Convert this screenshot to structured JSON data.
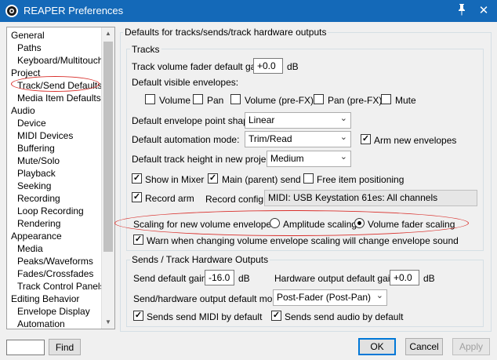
{
  "window": {
    "title": "REAPER Preferences",
    "pin_glyph": "📌",
    "close_glyph": "✕"
  },
  "tree": {
    "items": [
      {
        "label": "General"
      },
      {
        "label": "Paths"
      },
      {
        "label": "Keyboard/Multitouch"
      },
      {
        "label": "Project"
      },
      {
        "label": "Track/Send Defaults"
      },
      {
        "label": "Media Item Defaults"
      },
      {
        "label": "Audio"
      },
      {
        "label": "Device"
      },
      {
        "label": "MIDI Devices"
      },
      {
        "label": "Buffering"
      },
      {
        "label": "Mute/Solo"
      },
      {
        "label": "Playback"
      },
      {
        "label": "Seeking"
      },
      {
        "label": "Recording"
      },
      {
        "label": "Loop Recording"
      },
      {
        "label": "Rendering"
      },
      {
        "label": "Appearance"
      },
      {
        "label": "Media"
      },
      {
        "label": "Peaks/Waveforms"
      },
      {
        "label": "Fades/Crossfades"
      },
      {
        "label": "Track Control Panels"
      },
      {
        "label": "Editing Behavior"
      },
      {
        "label": "Envelope Display"
      },
      {
        "label": "Automation"
      }
    ],
    "scroll_up": "▲",
    "scroll_down": "▼"
  },
  "bottom": {
    "find_label": "Find",
    "ok_label": "OK",
    "cancel_label": "Cancel",
    "apply_label": "Apply"
  },
  "main": {
    "section_title": "Defaults for tracks/sends/track hardware outputs",
    "tracks": {
      "group_label": "Tracks",
      "vol_fader_label": "Track volume fader default gain:",
      "vol_fader_value": "+0.0",
      "vol_fader_unit": "dB",
      "visible_env_label": "Default visible envelopes:",
      "env_volume": "Volume",
      "env_pan": "Pan",
      "env_volume_prefx": "Volume (pre-FX)",
      "env_pan_prefx": "Pan (pre-FX)",
      "env_mute": "Mute",
      "point_shape_label": "Default envelope point shape:",
      "point_shape_value": "Linear",
      "auto_mode_label": "Default automation mode:",
      "auto_mode_value": "Trim/Read",
      "arm_new_env_label": "Arm new envelopes",
      "height_label": "Default track height in new projects:",
      "height_value": "Medium",
      "show_mixer_label": "Show in Mixer",
      "main_send_label": "Main (parent) send",
      "free_item_label": "Free item positioning",
      "record_arm_label": "Record arm",
      "record_config_label": "Record config:",
      "record_config_value": "MIDI: USB Keystation 61es: All channels",
      "scaling_label": "Scaling for new volume envelopes:",
      "amplitude_label": "Amplitude scaling",
      "fader_scaling_label": "Volume fader scaling",
      "warn_label": "Warn when changing volume envelope scaling will change envelope sound"
    },
    "sends": {
      "group_label": "Sends / Track Hardware Outputs",
      "send_gain_label": "Send default gain:",
      "send_gain_value": "-16.0",
      "send_gain_unit": "dB",
      "hw_gain_label": "Hardware output default gain:",
      "hw_gain_value": "+0.0",
      "hw_gain_unit": "dB",
      "mode_label": "Send/hardware output default mode:",
      "mode_value": "Post-Fader (Post-Pan)",
      "midi_label": "Sends send MIDI by default",
      "audio_label": "Sends send audio by default"
    }
  },
  "check_glyph": "✓",
  "combo_arrow": "⌄",
  "colors": {
    "titlebar": "#1469b8",
    "annotation": "#d9302c"
  }
}
